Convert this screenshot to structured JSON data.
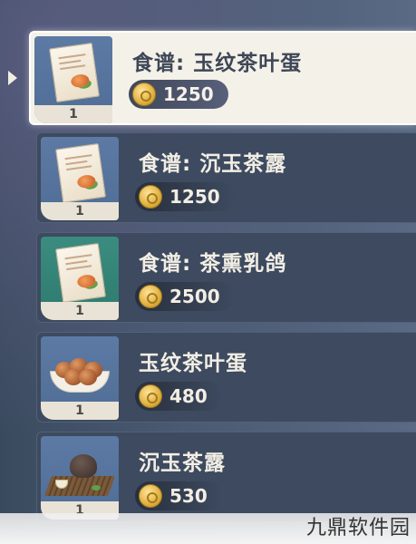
{
  "items": [
    {
      "title": "食谱: 玉纹茶叶蛋",
      "price": "1250",
      "qty": "1",
      "icon": "recipe-icon",
      "thumb": "blue",
      "selected": true
    },
    {
      "title": "食谱: 沉玉茶露",
      "price": "1250",
      "qty": "1",
      "icon": "recipe-icon",
      "thumb": "blue",
      "selected": false
    },
    {
      "title": "食谱: 茶熏乳鸽",
      "price": "2500",
      "qty": "1",
      "icon": "recipe-icon",
      "thumb": "green",
      "selected": false
    },
    {
      "title": "玉纹茶叶蛋",
      "price": "480",
      "qty": "1",
      "icon": "tea-egg-icon",
      "thumb": "blue",
      "selected": false
    },
    {
      "title": "沉玉茶露",
      "price": "530",
      "qty": "1",
      "icon": "tea-set-icon",
      "thumb": "blue",
      "selected": false
    }
  ],
  "watermark": "九鼎软件园",
  "colors": {
    "selected_bg": "#f4f1e9",
    "row_bg": "#3d4a5f",
    "thumb_blue": "#5c7aa4",
    "thumb_green": "#3b8c80",
    "coin": "#e0b040"
  }
}
